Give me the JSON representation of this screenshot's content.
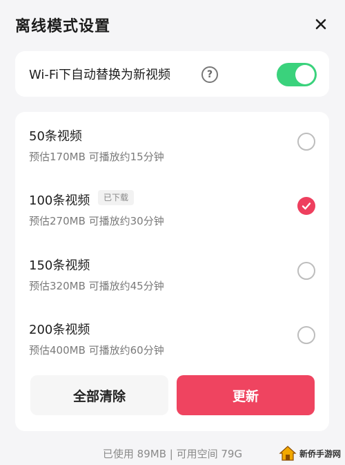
{
  "header": {
    "title": "离线模式设置"
  },
  "wifi": {
    "label": "Wi-Fi下自动替换为新视频",
    "help": "?",
    "enabled": true
  },
  "options": [
    {
      "name": "50条视频",
      "desc": "预估170MB 可播放约15分钟",
      "badge": "",
      "selected": false
    },
    {
      "name": "100条视频",
      "desc": "预估270MB 可播放约30分钟",
      "badge": "已下载",
      "selected": true
    },
    {
      "name": "150条视频",
      "desc": "预估320MB 可播放约45分钟",
      "badge": "",
      "selected": false
    },
    {
      "name": "200条视频",
      "desc": "预估400MB 可播放约60分钟",
      "badge": "",
      "selected": false
    }
  ],
  "buttons": {
    "clear": "全部清除",
    "update": "更新"
  },
  "footer": {
    "storage": "已使用 89MB | 可用空间 79G"
  },
  "watermark": {
    "text": "新侨手游网"
  },
  "colors": {
    "accent": "#ef4460",
    "toggle_on": "#3ad27c"
  }
}
